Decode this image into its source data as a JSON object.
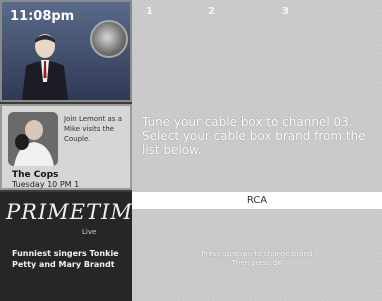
{
  "clock": "11:08pm",
  "tabs": [
    {
      "label": "1"
    },
    {
      "label": "2"
    },
    {
      "label": "3"
    }
  ],
  "sidebar": {
    "promo_text": "Join Lemont as a Mike visits the Couple.",
    "show_title": "The Cops",
    "show_time": "Tuesday 10 PM 1",
    "brand_logo": "PRIMETIME",
    "brand_sub": "Live",
    "brand_tagline": "Funniest singers Tonkie Petty and Mary Brandt"
  },
  "main": {
    "instruction": "Tune your cable box to channel 03. Select your cable box brand from the list below.",
    "brand_select": "RCA",
    "hint_line1": "Press up/down to change brand",
    "hint_line2": "Then press OK"
  }
}
